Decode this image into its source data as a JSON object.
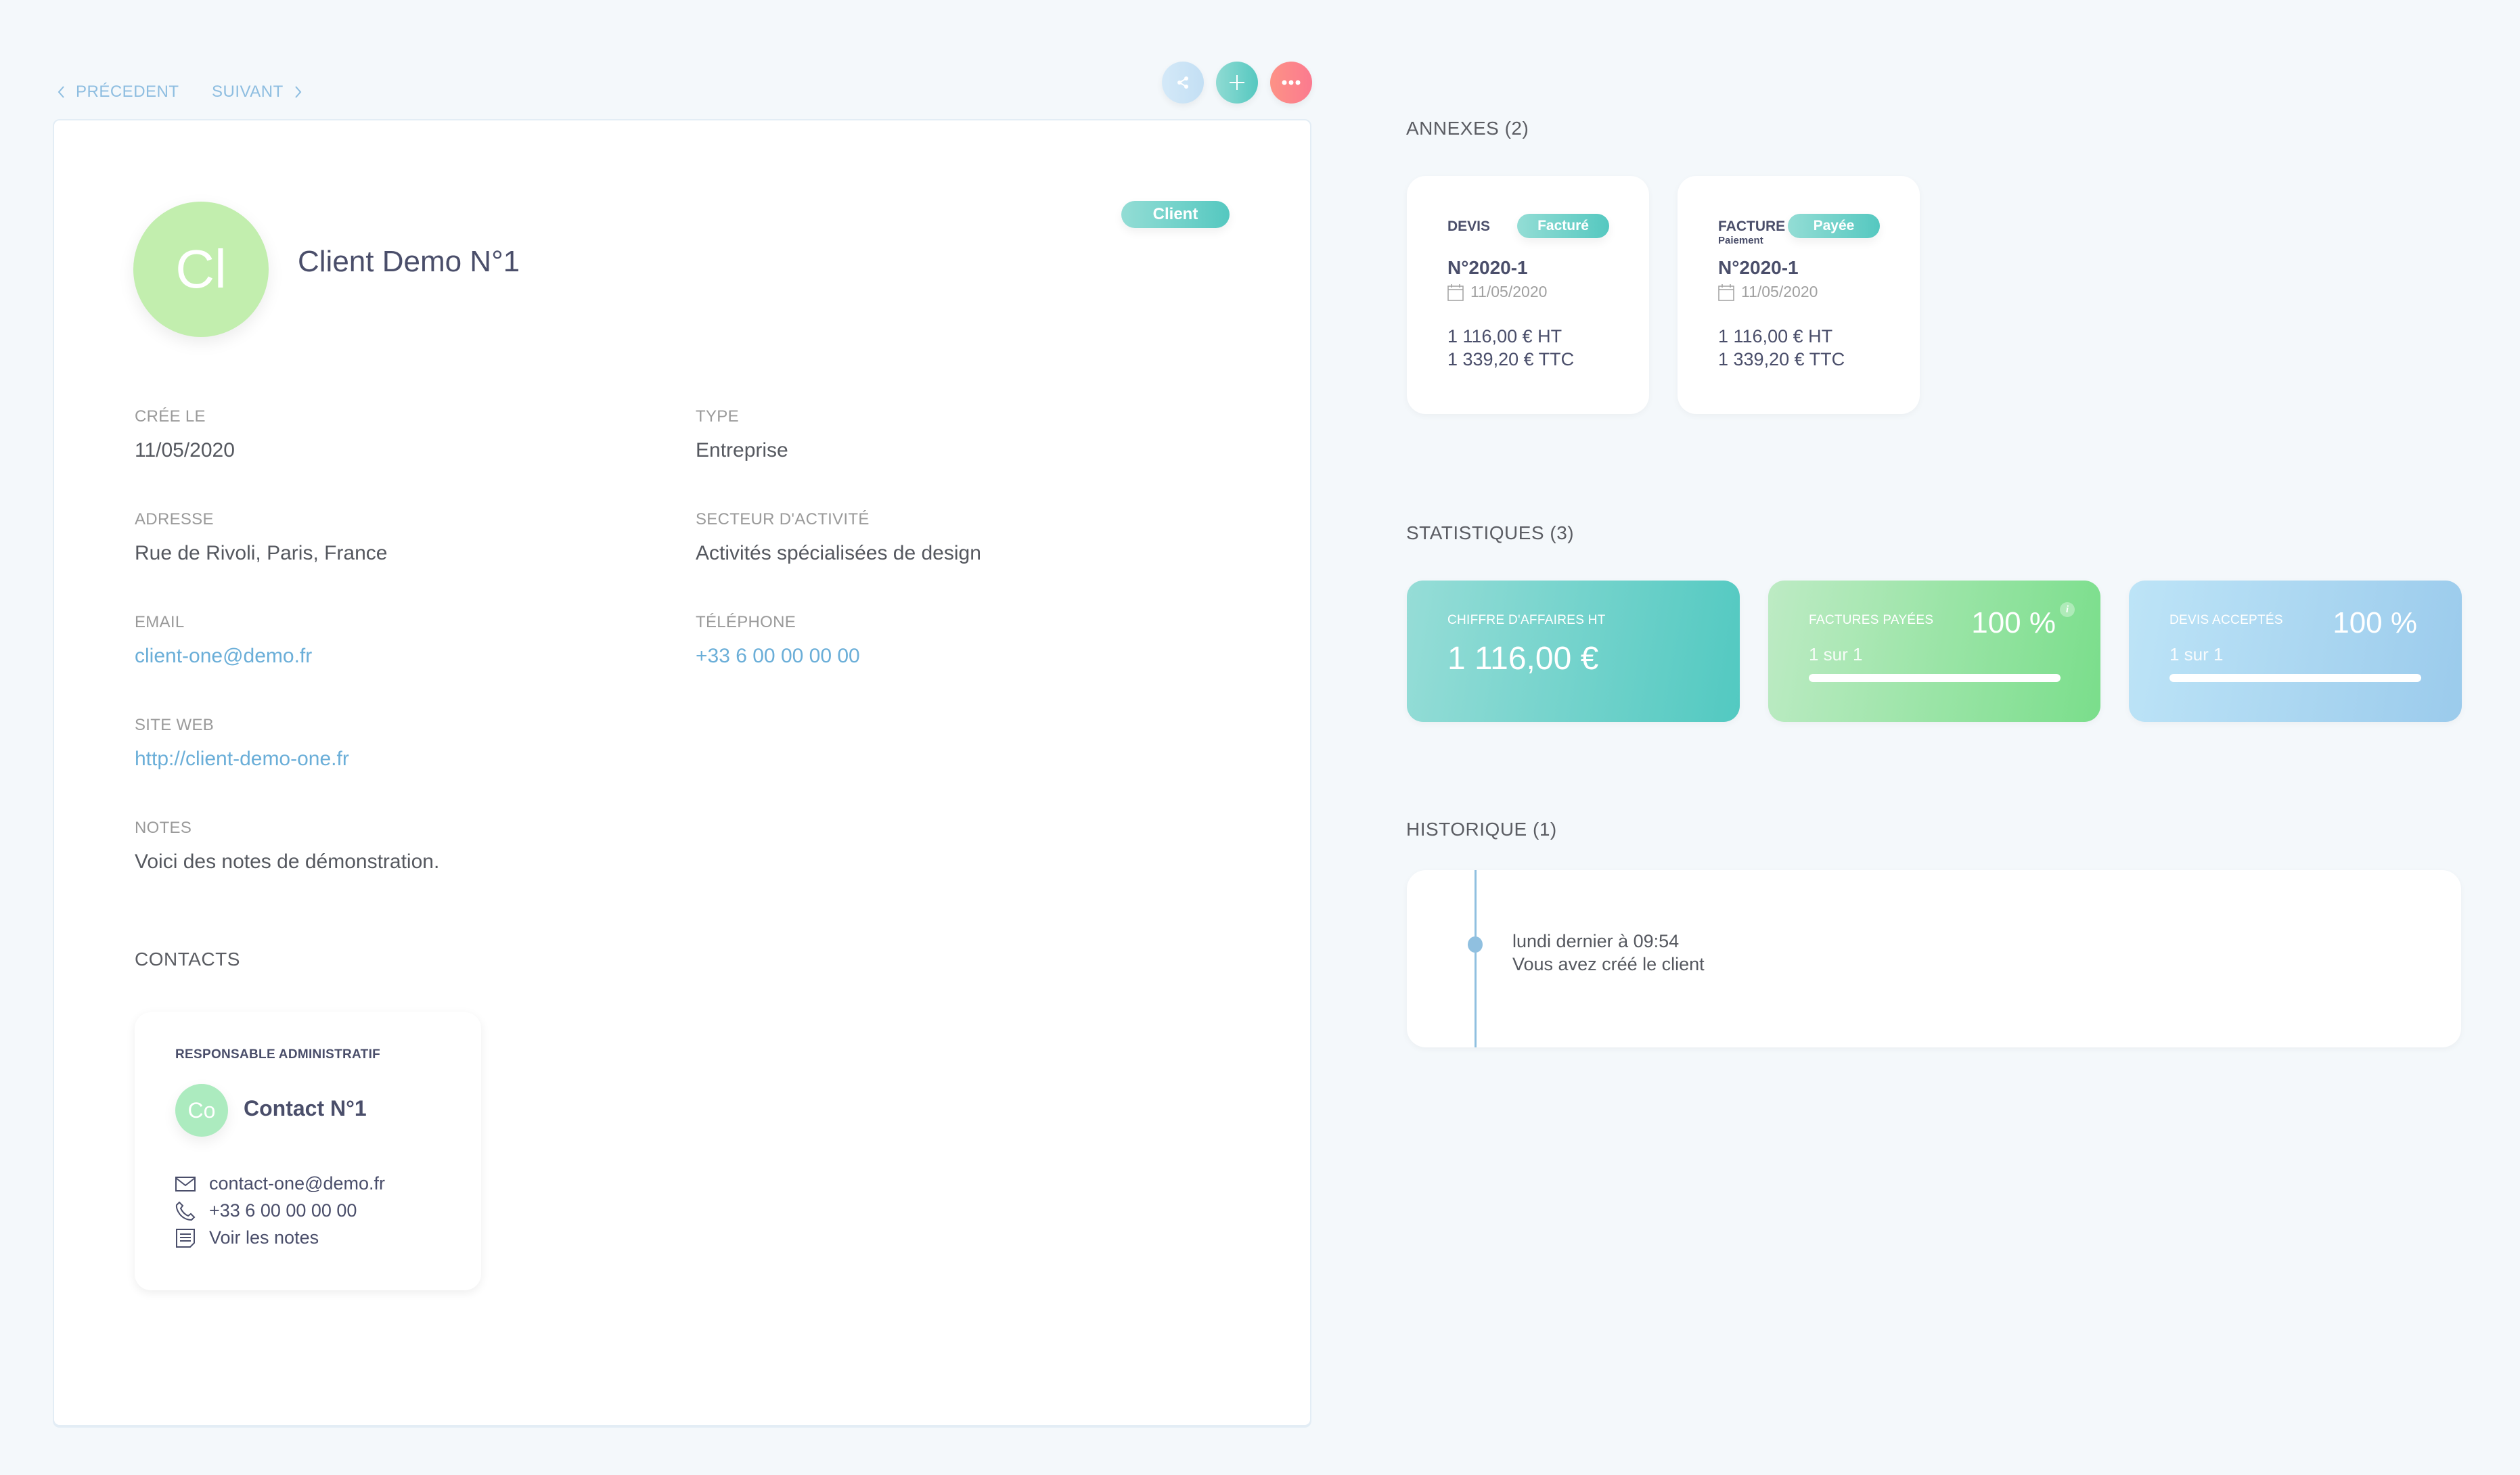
{
  "nav": {
    "previous_label": "PRÉCEDENT",
    "next_label": "SUIVANT"
  },
  "actions": {
    "share_icon": "share-icon",
    "add_icon": "plus-icon",
    "more_icon": "more-dots-icon"
  },
  "client": {
    "initials": "Cl",
    "name": "Client Demo N°1",
    "badge": "Client",
    "avatar_color": "#c2eeae",
    "fields": {
      "created_label": "CRÉE LE",
      "created_value": "11/05/2020",
      "type_label": "TYPE",
      "type_value": "Entreprise",
      "address_label": "ADRESSE",
      "address_value": "Rue de Rivoli, Paris, France",
      "sector_label": "SECTEUR D'ACTIVITÉ",
      "sector_value": "Activités spécialisées de design",
      "email_label": "EMAIL",
      "email_value": "client-one@demo.fr",
      "phone_label": "TÉLÉPHONE",
      "phone_value": "+33 6 00 00 00 00",
      "website_label": "SITE WEB",
      "website_value": "http://client-demo-one.fr",
      "notes_label": "NOTES",
      "notes_value": "Voici des notes de démonstration."
    }
  },
  "contacts": {
    "title": "CONTACTS",
    "items": [
      {
        "role": "RESPONSABLE ADMINISTRATIF",
        "initials": "Co",
        "name": "Contact N°1",
        "email": "contact-one@demo.fr",
        "phone": "+33 6 00 00 00 00",
        "notes_link": "Voir les notes"
      }
    ]
  },
  "annexes": {
    "title": "ANNEXES (2)",
    "items": [
      {
        "type": "DEVIS",
        "subtype": "",
        "status": "Facturé",
        "number": "N°2020-1",
        "date": "11/05/2020",
        "amount_ht": "1 116,00 € HT",
        "amount_ttc": "1 339,20 € TTC"
      },
      {
        "type": "FACTURE",
        "subtype": "Paiement",
        "status": "Payée",
        "number": "N°2020-1",
        "date": "11/05/2020",
        "amount_ht": "1 116,00 € HT",
        "amount_ttc": "1 339,20 € TTC"
      }
    ]
  },
  "statistics": {
    "title": "STATISTIQUES (3)",
    "revenue": {
      "label": "CHIFFRE D'AFFAIRES HT",
      "value": "1 116,00 €"
    },
    "paid_invoices": {
      "label": "FACTURES PAYÉES",
      "percent_label": "100 %",
      "sub": "1 sur 1",
      "progress": 1.0
    },
    "accepted_quotes": {
      "label": "DEVIS ACCEPTÉS",
      "percent_label": "100 %",
      "sub": "1 sur 1",
      "progress": 1.0
    }
  },
  "history": {
    "title": "HISTORIQUE (1)",
    "items": [
      {
        "time": "lundi dernier à 09:54",
        "text": "Vous avez créé le client"
      }
    ]
  },
  "colors": {
    "background": "#f4f8fb",
    "link": "#6aaed8",
    "teal": "#55c8c0",
    "green": "#7ade8b",
    "blue": "#9bcbec",
    "red": "#fb7a8f"
  }
}
